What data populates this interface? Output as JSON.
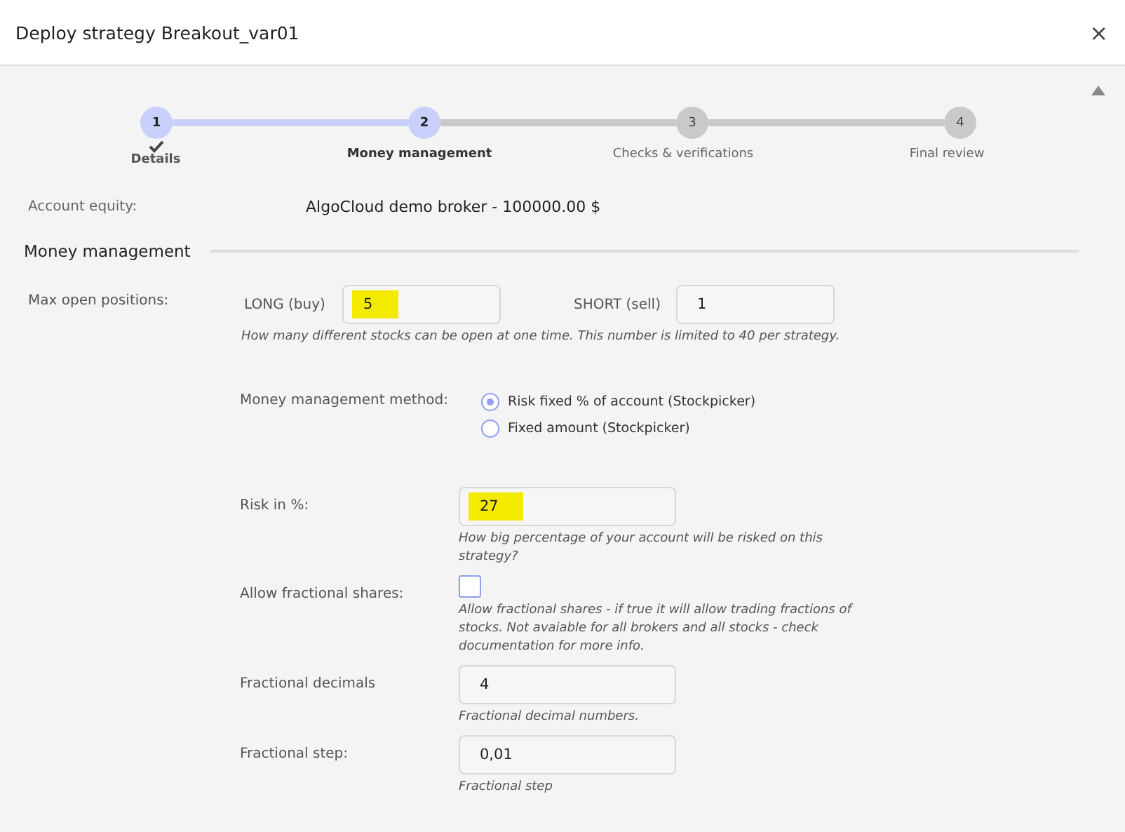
{
  "window": {
    "title": "Deploy strategy Breakout_var01",
    "close": "×"
  },
  "steps": [
    {
      "number": "1",
      "label": "Details",
      "completed": true,
      "current": false
    },
    {
      "number": "2",
      "label": "Money management",
      "completed": false,
      "current": true
    },
    {
      "number": "3",
      "label": "Checks & verifications",
      "completed": false,
      "current": false
    },
    {
      "number": "4",
      "label": "Final review",
      "completed": false,
      "current": false
    }
  ],
  "account_equity": {
    "label": "Account equity:",
    "value": "AlgoCloud demo broker - 100000.00 $"
  },
  "section": {
    "title": "Money management"
  },
  "max_open_positions": {
    "label": "Max open positions:",
    "fields": [
      {
        "label": "LONG (buy)",
        "value": "5",
        "highlighted": true
      },
      {
        "label": "SHORT (sell)",
        "value": "1",
        "highlighted": false
      }
    ],
    "hint": "How many different stocks can be open at one time. This number is limited to 40 per strategy."
  },
  "settings": [
    {
      "kind": "radio",
      "label": "Money management method:",
      "options": [
        {
          "label": "Risk fixed % of account (Stockpicker)",
          "selected": true
        },
        {
          "label": "Fixed amount (Stockpicker)",
          "selected": false
        }
      ]
    },
    {
      "kind": "input",
      "label": "Risk in %:",
      "value": "27",
      "highlighted": true,
      "hint": "How big percentage of your account will be risked on this strategy?"
    },
    {
      "kind": "checkbox",
      "label": "Allow fractional shares:",
      "checked": false,
      "hint": "Allow fractional shares - if true it will allow trading fractions of stocks. Not avaiable for all brokers and all stocks - check documentation for more info."
    },
    {
      "kind": "input",
      "label": "Fractional decimals",
      "value": "4",
      "highlighted": false,
      "hint": "Fractional decimal numbers."
    },
    {
      "kind": "input",
      "label": "Fractional step:",
      "value": "0,01",
      "highlighted": false,
      "hint": "Fractional step"
    }
  ]
}
